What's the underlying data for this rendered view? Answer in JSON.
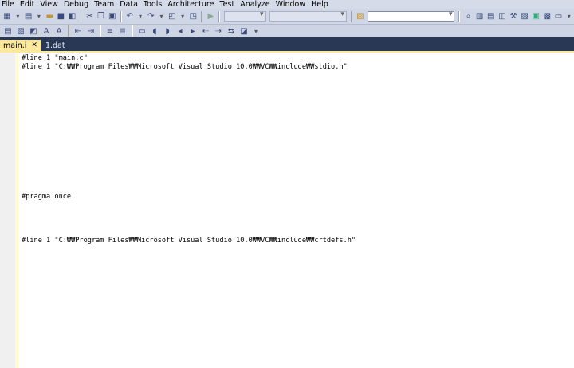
{
  "menu": [
    "File",
    "Edit",
    "View",
    "Debug",
    "Team",
    "Data",
    "Tools",
    "Architecture",
    "Test",
    "Analyze",
    "Window",
    "Help"
  ],
  "tabs": [
    {
      "label": "main.i",
      "active": true
    },
    {
      "label": "1.dat",
      "active": false
    }
  ],
  "code": [
    {
      "line": 1,
      "text": "#line 1 \"main.c\""
    },
    {
      "line": 2,
      "text": "#line 1 \"C:₩₩Program Files₩₩Microsoft Visual Studio 10.0₩₩VC₩₩include₩₩stdio.h\""
    },
    {
      "line": 18,
      "text": "#pragma once"
    },
    {
      "line": 23,
      "text": "#line 1 \"C:₩₩Program Files₩₩Microsoft Visual Studio 10.0₩₩VC₩₩include₩₩crtdefs.h\""
    }
  ],
  "colors": {
    "tabstrip": "#293955",
    "active_tab": "#fde99d",
    "toolbar": "#cfd6e5"
  }
}
